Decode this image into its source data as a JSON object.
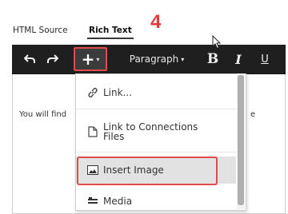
{
  "tabs": {
    "html_source": "HTML Source",
    "rich_text": "Rich Text"
  },
  "step_number": "4",
  "toolbar": {
    "insert_plus": "+",
    "caret": "▾",
    "paragraph": "Paragraph",
    "bold": "B",
    "italic": "I",
    "underline": "U"
  },
  "body": {
    "text_start": "You will find",
    "text_end": "e"
  },
  "insert_menu": {
    "items": [
      {
        "label": "Link...",
        "icon": "link-icon"
      },
      {
        "label": "Link to Connections Files",
        "icon": "file-icon"
      },
      {
        "label": "Insert Image",
        "icon": "image-icon",
        "highlighted": true
      },
      {
        "label": "Media",
        "icon": "media-icon"
      }
    ]
  },
  "colors": {
    "toolbar_bg": "#1f1f1f",
    "highlight_border": "#e04b4b",
    "step_number": "#e43a3a",
    "hover_bg": "#e2e2e2"
  }
}
